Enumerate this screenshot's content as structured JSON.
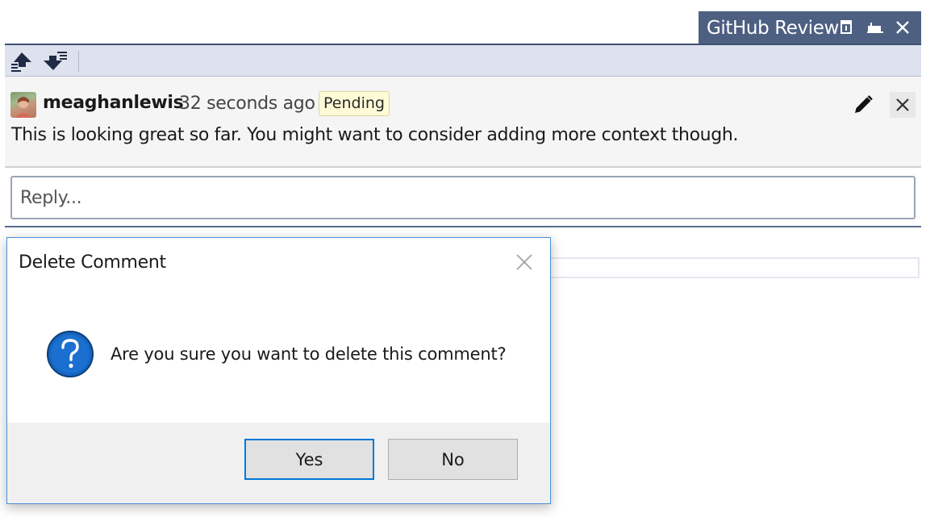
{
  "tab": {
    "title": "GitHub Review",
    "icons": [
      "pin-window-icon",
      "auto-hide-icon",
      "close-icon"
    ],
    "background": "#4d6082"
  },
  "toolbar": {
    "buttons": [
      {
        "icon": "previous-comment-icon"
      },
      {
        "icon": "next-comment-icon"
      }
    ]
  },
  "comment": {
    "author": "meaghanlewis",
    "time": "32 seconds ago",
    "status": "Pending",
    "body": "This is looking great so far. You might want to consider adding more context though.",
    "actions": [
      "edit-icon",
      "close-icon"
    ]
  },
  "reply": {
    "placeholder": "Reply..."
  },
  "dialog": {
    "title": "Delete Comment",
    "message": "Are you sure you want to delete this comment?",
    "icon": "question-icon",
    "buttons": {
      "yes": "Yes",
      "no": "No"
    },
    "accent": "#0078d7"
  }
}
